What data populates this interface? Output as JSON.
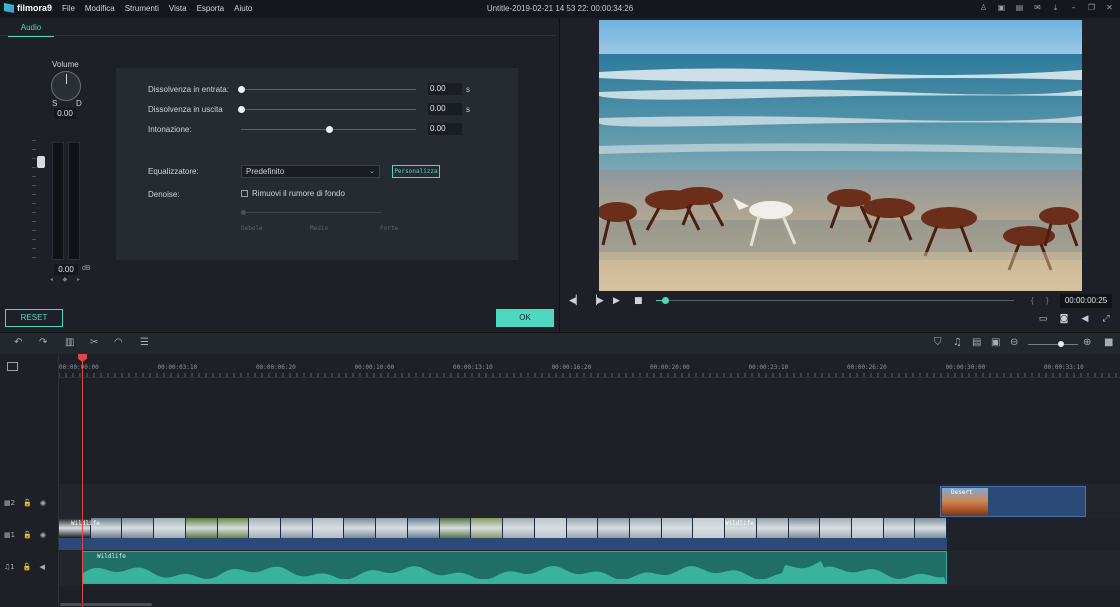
{
  "app": {
    "logo_text": "filmora9",
    "window_title": "Untitle-2019-02-21 14 53 22: 00:00:34:26"
  },
  "menu": [
    "File",
    "Modifica",
    "Strumenti",
    "Vista",
    "Esporta",
    "Aiuto"
  ],
  "window_icons": [
    "account-icon",
    "cart-icon",
    "gift-icon",
    "mail-icon",
    "download-icon",
    "minimize-icon",
    "maximize-icon",
    "close-icon"
  ],
  "audio_panel": {
    "tab": "Audio",
    "volume_label": "Volume",
    "knob_left": "S",
    "knob_right": "D",
    "knob_value": "0.00",
    "db_value": "0.00",
    "db_unit": "dB",
    "balance_marks": "◂ ◆ ▸",
    "rows": {
      "fade_in": {
        "label": "Dissolvenza in entrata:",
        "value": "0.00",
        "unit": "s",
        "level": 0
      },
      "fade_out": {
        "label": "Dissolvenza in uscita",
        "value": "0.00",
        "unit": "s",
        "level": 0
      },
      "pitch": {
        "label": "Intonazione:",
        "value": "0.00",
        "level": 0.5
      },
      "equalizer": {
        "label": "Equalizzatore:",
        "selected": "Predefinito",
        "customize_label": "Personalizza"
      },
      "denoise": {
        "label": "Denoise:",
        "checkbox_label": "Rimuovi il rumore di fondo",
        "checked": false,
        "levels": [
          "Debole",
          "Medio",
          "Forte"
        ]
      }
    },
    "reset_label": "RESET",
    "ok_label": "OK"
  },
  "preview": {
    "timecode": "00:00:00:25",
    "braces": "{ }",
    "playback_progress": 0.02
  },
  "timeline": {
    "ruler": [
      "00:00:00:00",
      "00:00:03:10",
      "00:00:06:20",
      "00:00:10:00",
      "00:00:13:10",
      "00:00:16:20",
      "00:00:20:00",
      "00:00:23:10",
      "00:00:26:20",
      "00:00:30:00",
      "00:00:33:10"
    ],
    "tracks": [
      {
        "name": "video-track-2",
        "number": "2"
      },
      {
        "name": "video-track-1",
        "number": "1"
      },
      {
        "name": "audio-track-1",
        "number": "1"
      }
    ],
    "pip_clip_label": "Desert",
    "video_clip_label": "Wildlife",
    "video_clip_label_2": "Wildlife",
    "audio_clip_label": "Wildlife",
    "zoom_level": 0.65
  },
  "colors": {
    "accent": "#4fd8c0",
    "playhead": "#e04848",
    "clip_video": "#2b4a78",
    "clip_audio": "#1f6f66"
  }
}
